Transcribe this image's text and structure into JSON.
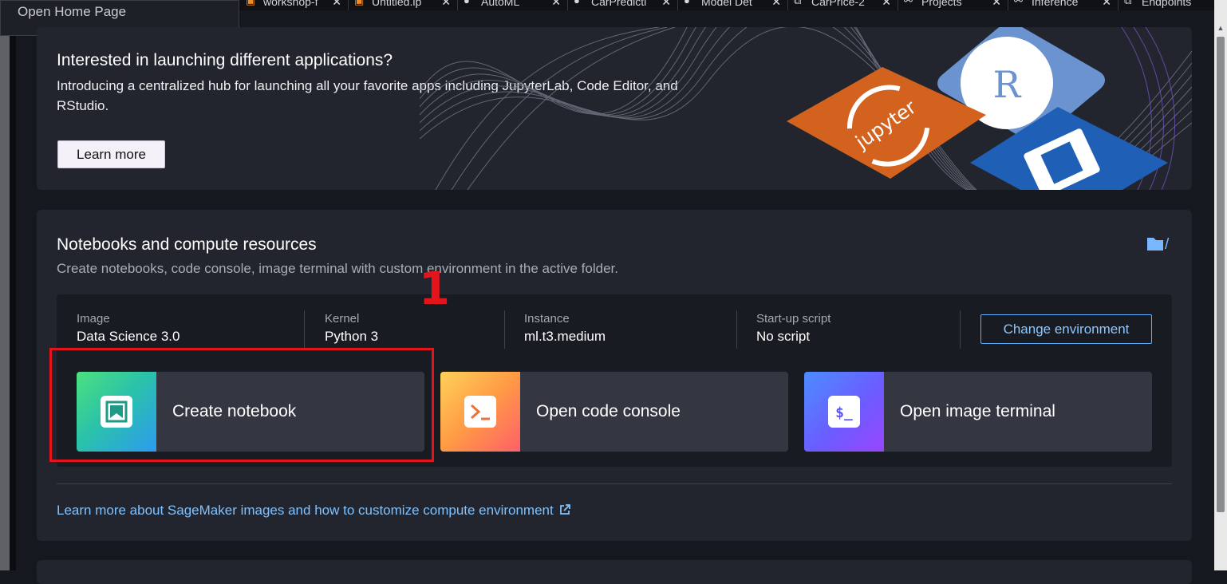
{
  "tooltip": {
    "text": "Open Home Page"
  },
  "tabs": [
    {
      "label": "workshop-f",
      "icon": "notebook-icon"
    },
    {
      "label": "Untitled.ip",
      "icon": "notebook-icon"
    },
    {
      "label": "AutoML",
      "icon": "person-icon"
    },
    {
      "label": "CarPredicti",
      "icon": "person-icon"
    },
    {
      "label": "Model Det",
      "icon": "person-icon"
    },
    {
      "label": "CarPrice-2",
      "icon": "cube-icon"
    },
    {
      "label": "Projects",
      "icon": "share-icon"
    },
    {
      "label": "Inference",
      "icon": "share-icon"
    },
    {
      "label": "Endpoints",
      "icon": "cube-icon"
    }
  ],
  "hero": {
    "title": "Interested in launching different applications?",
    "description": "Introducing a centralized hub for launching all your favorite apps including JupyterLab, Code Editor, and RStudio.",
    "button": "Learn more",
    "logos": {
      "r": "R",
      "jupyter": "jupyter"
    }
  },
  "notebooks": {
    "title": "Notebooks and compute resources",
    "subtitle": "Create notebooks, code console, image terminal with custom environment in the active folder.",
    "folder_path": "/",
    "environment": {
      "image": {
        "label": "Image",
        "value": "Data Science 3.0"
      },
      "kernel": {
        "label": "Kernel",
        "value": "Python 3"
      },
      "instance": {
        "label": "Instance",
        "value": "ml.t3.medium"
      },
      "startup": {
        "label": "Start-up script",
        "value": "No script"
      }
    },
    "change_button": "Change environment",
    "actions": {
      "create_notebook": "Create notebook",
      "code_console": "Open code console",
      "image_terminal": "Open image terminal",
      "terminal_glyph": "$_"
    },
    "learn_link": "Learn more about SageMaker images and how to customize compute environment",
    "learn_link_icon": "external-link-icon"
  },
  "annotation": {
    "step_number": "1",
    "color": "#e3141c"
  },
  "colors": {
    "background": "#15181f",
    "card": "#22252e",
    "accent_link": "#7fc2ff",
    "jupyter_orange": "#d4621f",
    "r_blue": "#6a93cf",
    "editor_blue": "#1f5fb5"
  }
}
